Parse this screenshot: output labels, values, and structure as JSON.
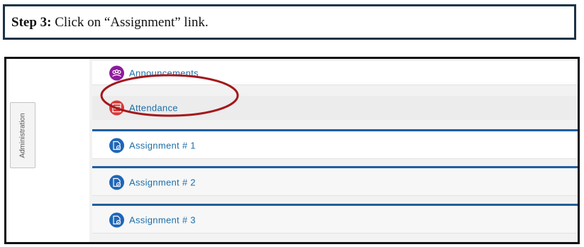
{
  "instruction": {
    "step_label": "Step 3:",
    "step_text": " Click on “Assignment” link."
  },
  "sidebar": {
    "admin_tab_label": "Administration"
  },
  "course_items": [
    {
      "label": "Announcements",
      "icon": "announcements-icon",
      "icon_color": "#8e1b9c"
    },
    {
      "label": "Attendance",
      "icon": "attendance-icon",
      "icon_color": "#d93a3a"
    },
    {
      "label": "Assignment # 1",
      "icon": "assignment-icon",
      "icon_color": "#1f66b8",
      "highlighted": true
    },
    {
      "label": "Assignment # 2",
      "icon": "assignment-icon",
      "icon_color": "#1f66b8"
    },
    {
      "label": "Assignment # 3",
      "icon": "assignment-icon",
      "icon_color": "#1f66b8"
    }
  ],
  "colors": {
    "frame_border": "#1c3347",
    "link_text": "#1d6fa8",
    "divider": "#1f5fa0",
    "highlight": "#a3171c"
  }
}
